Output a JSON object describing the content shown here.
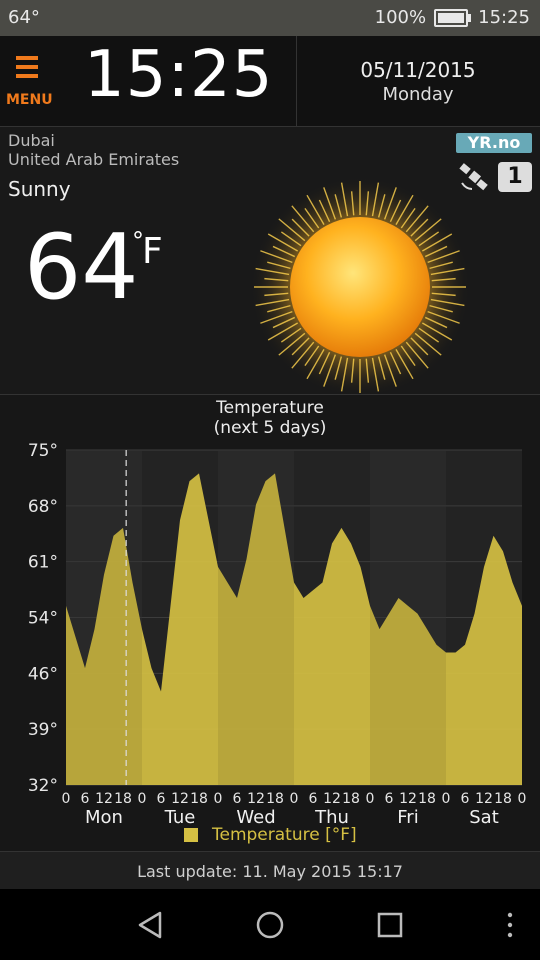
{
  "status_bar": {
    "left_text": "64°",
    "battery_percent": "100%",
    "battery_level": 1.0,
    "time": "15:25"
  },
  "header": {
    "menu_label": "MENU",
    "clock": "15:25",
    "date": "05/11/2015",
    "weekday": "Monday",
    "accent_color": "#f07a1c"
  },
  "current": {
    "city": "Dubai",
    "country": "United Arab Emirates",
    "condition": "Sunny",
    "temperature": "64",
    "degree_symbol": "°",
    "unit": "F",
    "icon": "sun-icon",
    "provider_logo": "YR.no",
    "source_badge": "1"
  },
  "chart_data": {
    "type": "area",
    "title": "Temperature",
    "subtitle": "(next 5 days)",
    "ylim": [
      32,
      75
    ],
    "y_ticks": [
      "75°",
      "68°",
      "61°",
      "54°",
      "46°",
      "39°",
      "32°"
    ],
    "x_hours": [
      "0",
      "6",
      "12",
      "18",
      "0",
      "6",
      "12",
      "18",
      "0",
      "6",
      "12",
      "18",
      "0",
      "6",
      "12",
      "18",
      "0",
      "6",
      "12",
      "18",
      "0",
      "6",
      "12",
      "18",
      "0"
    ],
    "days": [
      "Mon",
      "Tue",
      "Wed",
      "Thu",
      "Fri",
      "Sat"
    ],
    "series": [
      {
        "name": "Temperature [°F]",
        "color": "#d5c043",
        "x": [
          0,
          3,
          6,
          9,
          12,
          15,
          18,
          21,
          24,
          27,
          30,
          33,
          36,
          39,
          42,
          45,
          48,
          51,
          54,
          57,
          60,
          63,
          66,
          69,
          72,
          75,
          78,
          81,
          84,
          87,
          90,
          93,
          96,
          99,
          102,
          105,
          108,
          111,
          114,
          117,
          120,
          123,
          126,
          129,
          132,
          135,
          138,
          141,
          144
        ],
        "values": [
          55,
          51,
          47,
          52,
          59,
          64,
          65,
          58,
          52,
          47,
          44,
          55,
          66,
          71,
          72,
          66,
          60,
          58,
          56,
          61,
          68,
          71,
          72,
          65,
          58,
          56,
          57,
          58,
          63,
          65,
          63,
          60,
          55,
          52,
          54,
          56,
          55,
          54,
          52,
          50,
          49,
          49,
          50,
          54,
          60,
          64,
          62,
          58,
          55
        ]
      }
    ],
    "current_time_x": 19,
    "grid": true
  },
  "legend": {
    "label": "Temperature [°F]",
    "color": "#d5c043"
  },
  "footer": {
    "last_update": "Last update: 11. May 2015  15:17"
  },
  "navbar": {
    "back": "back-icon",
    "home": "home-icon",
    "recents": "recents-icon",
    "more": "more-icon"
  }
}
